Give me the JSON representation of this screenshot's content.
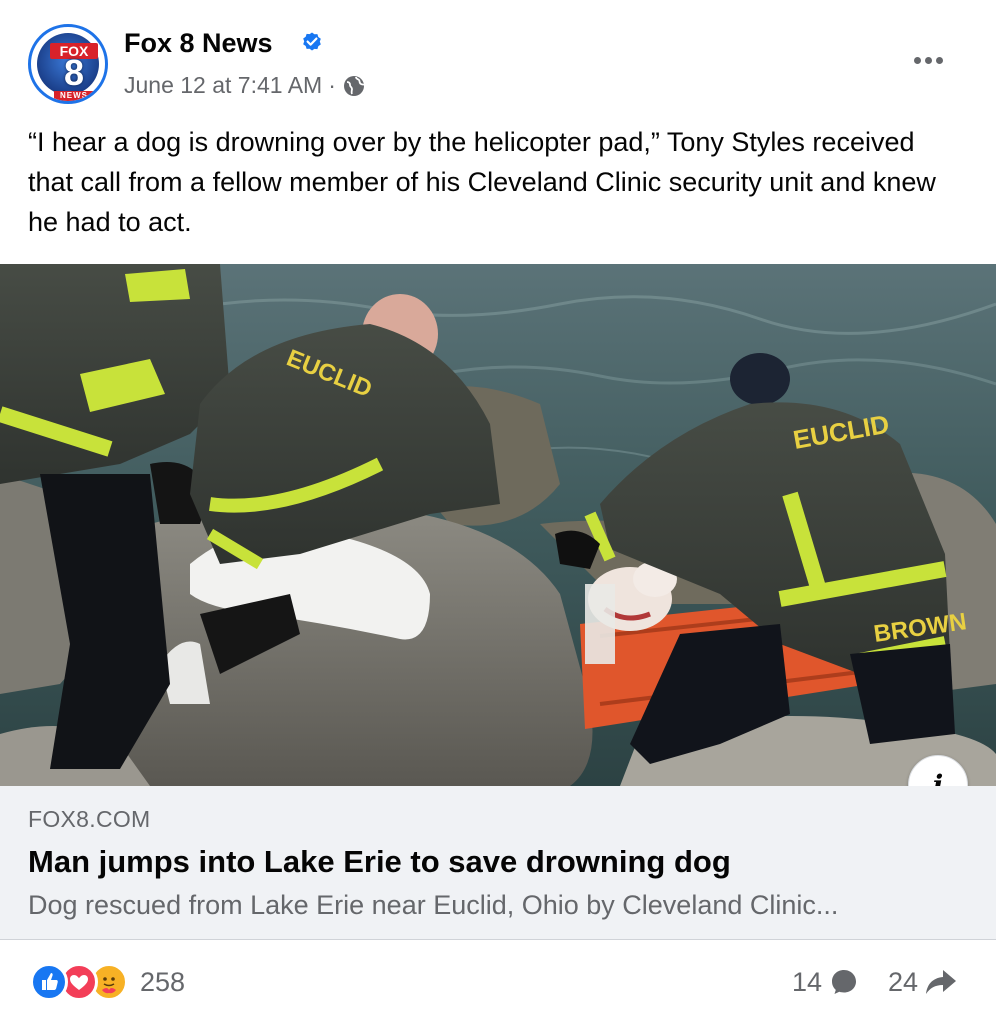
{
  "post": {
    "page_name": "Fox 8 News",
    "avatar_text": {
      "brand": "FOX",
      "number": "8",
      "sub": "NEWS"
    },
    "timestamp": "June 12 at 7:41 AM",
    "separator": "·",
    "audience_icon": "globe-icon",
    "verified_icon": "verified-badge-icon",
    "caption": "“I hear a dog is drowning over by the helicopter pad,” Tony Styles received that call from a fellow member of his Cleveland Clinic security unit and knew he had to act."
  },
  "photo": {
    "jacket_text_left": "EUCLID",
    "jacket_text_right": "EUCLID",
    "name_tag": "BROWN",
    "info_label": "i"
  },
  "link": {
    "domain": "FOX8.COM",
    "title": "Man jumps into Lake Erie to save drowning dog",
    "description": "Dog rescued from Lake Erie near Euclid, Ohio by Cleveland Clinic..."
  },
  "engagement": {
    "reaction_icons": [
      "like-icon",
      "love-icon",
      "care-icon"
    ],
    "reaction_count": "258",
    "comment_count": "14",
    "share_count": "24"
  },
  "colors": {
    "accent": "#1877f2",
    "love": "#f33e58",
    "care": "#f7b125",
    "secondary_text": "#65676b",
    "link_bg": "#f0f2f5"
  }
}
